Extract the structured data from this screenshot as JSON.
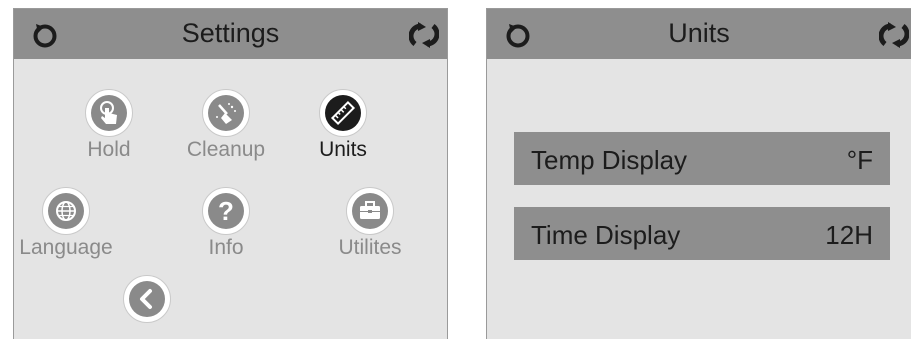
{
  "settings": {
    "title": "Settings",
    "items": [
      {
        "label": "Hold",
        "icon": "hand-touch-icon",
        "active": false
      },
      {
        "label": "Cleanup",
        "icon": "broom-icon",
        "active": false
      },
      {
        "label": "Units",
        "icon": "ruler-icon",
        "active": true
      },
      {
        "label": "Language",
        "icon": "globe-icon",
        "active": false
      },
      {
        "label": "Info",
        "icon": "question-icon",
        "active": false
      },
      {
        "label": "Utilites",
        "icon": "toolbox-icon",
        "active": false
      }
    ],
    "back_icon": "back-arrow-icon"
  },
  "units": {
    "title": "Units",
    "rows": [
      {
        "label": "Temp Display",
        "value": "°F"
      },
      {
        "label": "Time Display",
        "value": "12H"
      }
    ]
  },
  "colors": {
    "header": "#8e8e8e",
    "panel": "#e4e4e4",
    "inactive": "#8a8a8a",
    "active": "#1c1c1c"
  }
}
